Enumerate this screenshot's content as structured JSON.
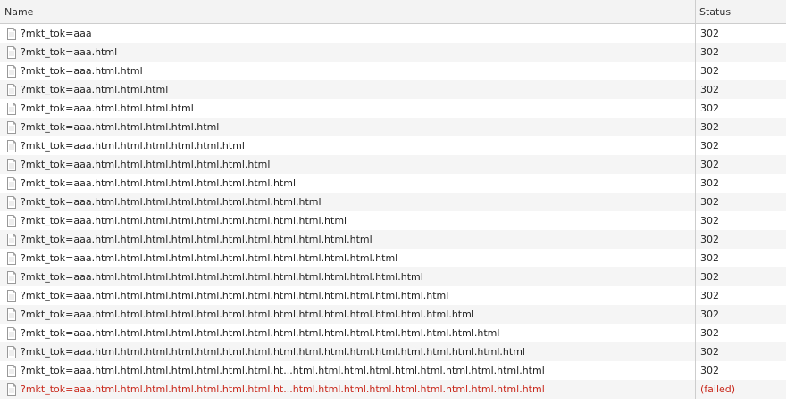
{
  "header": {
    "name": "Name",
    "status": "Status"
  },
  "rows": [
    {
      "name": "?mkt_tok=aaa",
      "status": "302"
    },
    {
      "name": "?mkt_tok=aaa.html",
      "status": "302"
    },
    {
      "name": "?mkt_tok=aaa.html.html",
      "status": "302"
    },
    {
      "name": "?mkt_tok=aaa.html.html.html",
      "status": "302"
    },
    {
      "name": "?mkt_tok=aaa.html.html.html.html",
      "status": "302"
    },
    {
      "name": "?mkt_tok=aaa.html.html.html.html.html",
      "status": "302"
    },
    {
      "name": "?mkt_tok=aaa.html.html.html.html.html.html",
      "status": "302"
    },
    {
      "name": "?mkt_tok=aaa.html.html.html.html.html.html.html",
      "status": "302"
    },
    {
      "name": "?mkt_tok=aaa.html.html.html.html.html.html.html.html",
      "status": "302"
    },
    {
      "name": "?mkt_tok=aaa.html.html.html.html.html.html.html.html.html",
      "status": "302"
    },
    {
      "name": "?mkt_tok=aaa.html.html.html.html.html.html.html.html.html.html",
      "status": "302"
    },
    {
      "name": "?mkt_tok=aaa.html.html.html.html.html.html.html.html.html.html.html",
      "status": "302"
    },
    {
      "name": "?mkt_tok=aaa.html.html.html.html.html.html.html.html.html.html.html.html",
      "status": "302"
    },
    {
      "name": "?mkt_tok=aaa.html.html.html.html.html.html.html.html.html.html.html.html.html",
      "status": "302"
    },
    {
      "name": "?mkt_tok=aaa.html.html.html.html.html.html.html.html.html.html.html.html.html.html",
      "status": "302"
    },
    {
      "name": "?mkt_tok=aaa.html.html.html.html.html.html.html.html.html.html.html.html.html.html.html",
      "status": "302"
    },
    {
      "name": "?mkt_tok=aaa.html.html.html.html.html.html.html.html.html.html.html.html.html.html.html.html",
      "status": "302"
    },
    {
      "name": "?mkt_tok=aaa.html.html.html.html.html.html.html.html.html.html.html.html.html.html.html.html.html",
      "status": "302"
    },
    {
      "name": "?mkt_tok=aaa.html.html.html.html.html.html.html.ht...html.html.html.html.html.html.html.html.html.html",
      "status": "302"
    },
    {
      "name": "?mkt_tok=aaa.html.html.html.html.html.html.html.ht...html.html.html.html.html.html.html.html.html.html",
      "status": "(failed)",
      "failed": true
    }
  ],
  "colors": {
    "failed": "#c8281b",
    "header_bg": "#f3f3f3",
    "row_alt_bg": "#f5f5f5"
  },
  "icons": {
    "row_icon": "document-icon"
  }
}
